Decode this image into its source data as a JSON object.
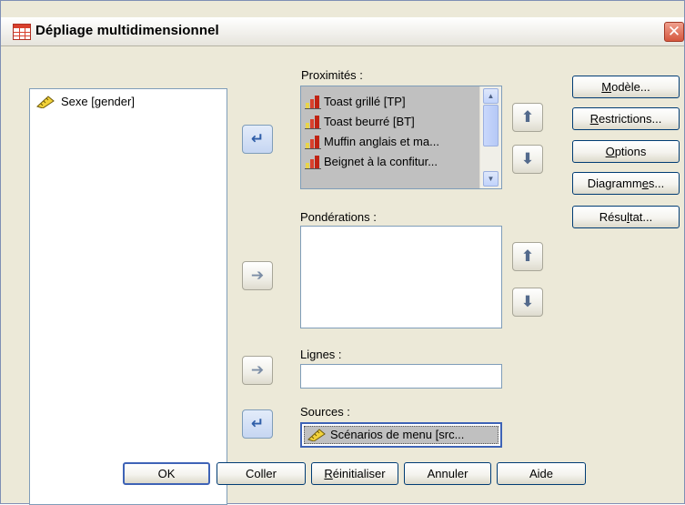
{
  "window": {
    "title": "Dépliage multidimensionnel",
    "close_glyph": "✕"
  },
  "variables": {
    "items": [
      {
        "label": "Sexe [gender]",
        "icon": "ruler-icon"
      }
    ]
  },
  "proximities": {
    "label": "Proximités :",
    "items": [
      {
        "label": "Toast grillé [TP]",
        "icon": "bar-chart-icon"
      },
      {
        "label": "Toast beurré [BT]",
        "icon": "bar-chart-icon"
      },
      {
        "label": "Muffin anglais et ma...",
        "icon": "bar-chart-icon"
      },
      {
        "label": "Beignet à la confitur...",
        "icon": "bar-chart-icon"
      }
    ]
  },
  "weights": {
    "label": "Pondérations :"
  },
  "rows": {
    "label": "Lignes :",
    "value": ""
  },
  "sources": {
    "label": "Sources :",
    "value": "Scénarios de menu [src..."
  },
  "side_buttons": {
    "model": {
      "pre": "",
      "u": "M",
      "post": "odèle..."
    },
    "restrictions": {
      "pre": "",
      "u": "R",
      "post": "estrictions..."
    },
    "options": {
      "pre": "",
      "u": "O",
      "post": "ptions"
    },
    "diagrams": {
      "pre": "Diagramm",
      "u": "e",
      "post": "s..."
    },
    "output": {
      "pre": "Résu",
      "u": "l",
      "post": "tat..."
    }
  },
  "bottom_buttons": {
    "ok": "OK",
    "paste": "Coller",
    "reset": {
      "u": "R",
      "post": "éinitialiser"
    },
    "cancel": "Annuler",
    "help": "Aide"
  },
  "colors": {
    "dialog_bg": "#ece9d8",
    "selection": "#c0c0c0",
    "focus_border": "#3e63b6",
    "close_red": "#d5573e"
  }
}
